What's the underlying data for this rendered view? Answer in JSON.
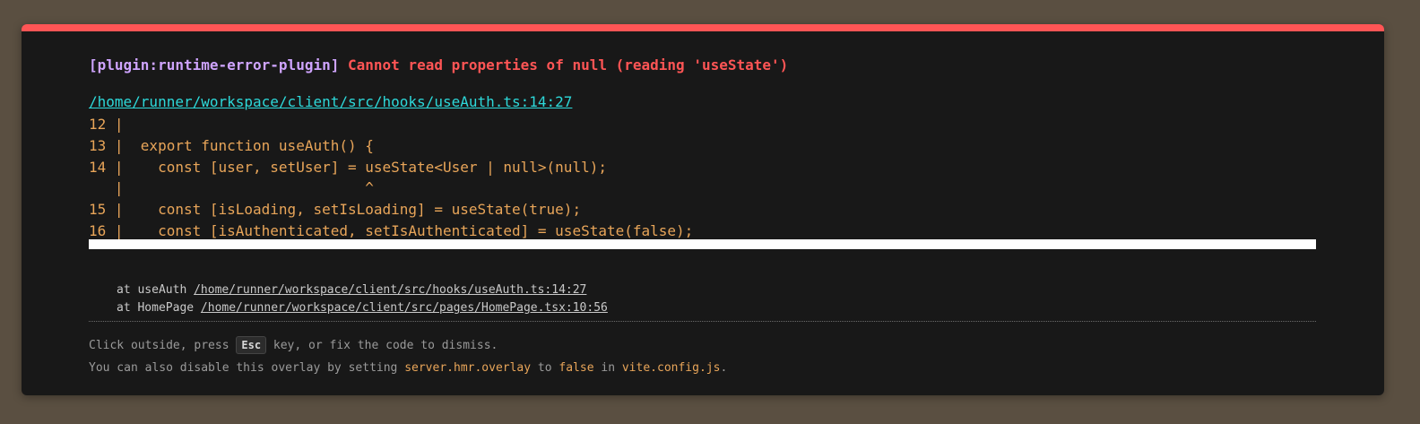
{
  "error": {
    "plugin": "[plugin:runtime-error-plugin]",
    "message": "Cannot read properties of null (reading 'useState')",
    "file_link": "/home/runner/workspace/client/src/hooks/useAuth.ts:14:27"
  },
  "frame_lines": [
    "12 |",
    "13 |  export function useAuth() {",
    "14 |    const [user, setUser] = useState<User | null>(null);",
    "   |                            ^",
    "15 |    const [isLoading, setIsLoading] = useState(true);",
    "16 |    const [isAuthenticated, setIsAuthenticated] = useState(false);"
  ],
  "stack": [
    {
      "prefix": "at useAuth ",
      "link": "/home/runner/workspace/client/src/hooks/useAuth.ts:14:27"
    },
    {
      "prefix": "at HomePage ",
      "link": "/home/runner/workspace/client/src/pages/HomePage.tsx:10:56"
    }
  ],
  "tip": {
    "line1_before": "Click outside, press ",
    "key": "Esc",
    "line1_after": " key, or fix the code to dismiss.",
    "line2_before": "You can also disable this overlay by setting ",
    "setting": "server.hmr.overlay",
    "line2_mid": " to ",
    "value": "false",
    "line2_in": " in ",
    "file": "vite.config.js",
    "line2_end": "."
  },
  "colors": {
    "accent_red": "#ff5555",
    "plugin_purple": "#cfa4ff",
    "link_cyan": "#2dd9da",
    "code_orange": "#e8a559"
  }
}
